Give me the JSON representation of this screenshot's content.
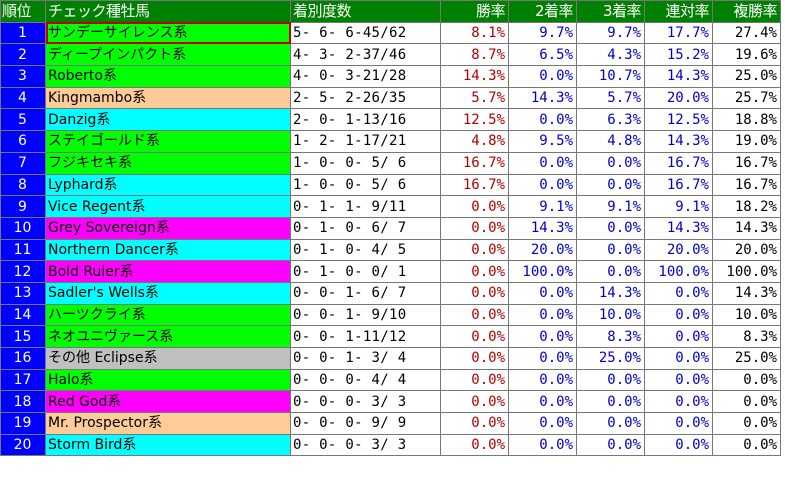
{
  "colors": {
    "header_bg": "#008000",
    "rank_bg": "#0000ff",
    "win_rate_text": "#b00000",
    "place_rate_text": "#0000cc",
    "green": "#00ff00",
    "cyan": "#00ffff",
    "orange": "#ffcc99",
    "magenta": "#ff00ff",
    "gray": "#c0c0c0"
  },
  "header": {
    "rank": "順位",
    "sire_line": "チェック種牡馬",
    "record": "着別度数",
    "win_rate": "勝率",
    "second_rate": "2着率",
    "third_rate": "3着率",
    "quinella_rate": "連対率",
    "show_rate": "複勝率"
  },
  "rows": [
    {
      "rank": "1",
      "name": "サンデーサイレンス系",
      "color": "#00ff00",
      "record": "5- 6- 6-45/62",
      "win": "8.1%",
      "second": "9.7%",
      "third": "9.7%",
      "quinella": "17.7%",
      "show": "27.4%"
    },
    {
      "rank": "2",
      "name": "ディープインパクト系",
      "color": "#00ff00",
      "record": "4- 3- 2-37/46",
      "win": "8.7%",
      "second": "6.5%",
      "third": "4.3%",
      "quinella": "15.2%",
      "show": "19.6%"
    },
    {
      "rank": "3",
      "name": "Roberto系",
      "color": "#00ff00",
      "record": "4- 0- 3-21/28",
      "win": "14.3%",
      "second": "0.0%",
      "third": "10.7%",
      "quinella": "14.3%",
      "show": "25.0%"
    },
    {
      "rank": "4",
      "name": "Kingmambo系",
      "color": "#ffcc99",
      "record": "2- 5- 2-26/35",
      "win": "5.7%",
      "second": "14.3%",
      "third": "5.7%",
      "quinella": "20.0%",
      "show": "25.7%"
    },
    {
      "rank": "5",
      "name": "Danzig系",
      "color": "#00ffff",
      "record": "2- 0- 1-13/16",
      "win": "12.5%",
      "second": "0.0%",
      "third": "6.3%",
      "quinella": "12.5%",
      "show": "18.8%"
    },
    {
      "rank": "6",
      "name": "ステイゴールド系",
      "color": "#00ff00",
      "record": "1- 2- 1-17/21",
      "win": "4.8%",
      "second": "9.5%",
      "third": "4.8%",
      "quinella": "14.3%",
      "show": "19.0%"
    },
    {
      "rank": "7",
      "name": "フジキセキ系",
      "color": "#00ff00",
      "record": "1- 0- 0- 5/ 6",
      "win": "16.7%",
      "second": "0.0%",
      "third": "0.0%",
      "quinella": "16.7%",
      "show": "16.7%"
    },
    {
      "rank": "8",
      "name": "Lyphard系",
      "color": "#00ffff",
      "record": "1- 0- 0- 5/ 6",
      "win": "16.7%",
      "second": "0.0%",
      "third": "0.0%",
      "quinella": "16.7%",
      "show": "16.7%"
    },
    {
      "rank": "9",
      "name": "Vice Regent系",
      "color": "#00ffff",
      "record": "0- 1- 1- 9/11",
      "win": "0.0%",
      "second": "9.1%",
      "third": "9.1%",
      "quinella": "9.1%",
      "show": "18.2%"
    },
    {
      "rank": "10",
      "name": "Grey Sovereign系",
      "color": "#ff00ff",
      "record": "0- 1- 0- 6/ 7",
      "win": "0.0%",
      "second": "14.3%",
      "third": "0.0%",
      "quinella": "14.3%",
      "show": "14.3%"
    },
    {
      "rank": "11",
      "name": "Northern Dancer系",
      "color": "#00ffff",
      "record": "0- 1- 0- 4/ 5",
      "win": "0.0%",
      "second": "20.0%",
      "third": "0.0%",
      "quinella": "20.0%",
      "show": "20.0%"
    },
    {
      "rank": "12",
      "name": "Bold Ruler系",
      "color": "#ff00ff",
      "record": "0- 1- 0- 0/ 1",
      "win": "0.0%",
      "second": "100.0%",
      "third": "0.0%",
      "quinella": "100.0%",
      "show": "100.0%"
    },
    {
      "rank": "13",
      "name": "Sadler's Wells系",
      "color": "#00ffff",
      "record": "0- 0- 1- 6/ 7",
      "win": "0.0%",
      "second": "0.0%",
      "third": "14.3%",
      "quinella": "0.0%",
      "show": "14.3%"
    },
    {
      "rank": "14",
      "name": "ハーツクライ系",
      "color": "#00ff00",
      "record": "0- 0- 1- 9/10",
      "win": "0.0%",
      "second": "0.0%",
      "third": "10.0%",
      "quinella": "0.0%",
      "show": "10.0%"
    },
    {
      "rank": "15",
      "name": "ネオユニヴァース系",
      "color": "#00ff00",
      "record": "0- 0- 1-11/12",
      "win": "0.0%",
      "second": "0.0%",
      "third": "8.3%",
      "quinella": "0.0%",
      "show": "8.3%"
    },
    {
      "rank": "16",
      "name": "その他 Eclipse系",
      "color": "#c0c0c0",
      "record": "0- 0- 1- 3/ 4",
      "win": "0.0%",
      "second": "0.0%",
      "third": "25.0%",
      "quinella": "0.0%",
      "show": "25.0%"
    },
    {
      "rank": "17",
      "name": "Halo系",
      "color": "#00ff00",
      "record": "0- 0- 0- 4/ 4",
      "win": "0.0%",
      "second": "0.0%",
      "third": "0.0%",
      "quinella": "0.0%",
      "show": "0.0%"
    },
    {
      "rank": "18",
      "name": "Red God系",
      "color": "#ff00ff",
      "record": "0- 0- 0- 3/ 3",
      "win": "0.0%",
      "second": "0.0%",
      "third": "0.0%",
      "quinella": "0.0%",
      "show": "0.0%"
    },
    {
      "rank": "19",
      "name": "Mr. Prospector系",
      "color": "#ffcc99",
      "record": "0- 0- 0- 9/ 9",
      "win": "0.0%",
      "second": "0.0%",
      "third": "0.0%",
      "quinella": "0.0%",
      "show": "0.0%"
    },
    {
      "rank": "20",
      "name": "Storm Bird系",
      "color": "#00ffff",
      "record": "0- 0- 0- 3/ 3",
      "win": "0.0%",
      "second": "0.0%",
      "third": "0.0%",
      "quinella": "0.0%",
      "show": "0.0%"
    }
  ]
}
